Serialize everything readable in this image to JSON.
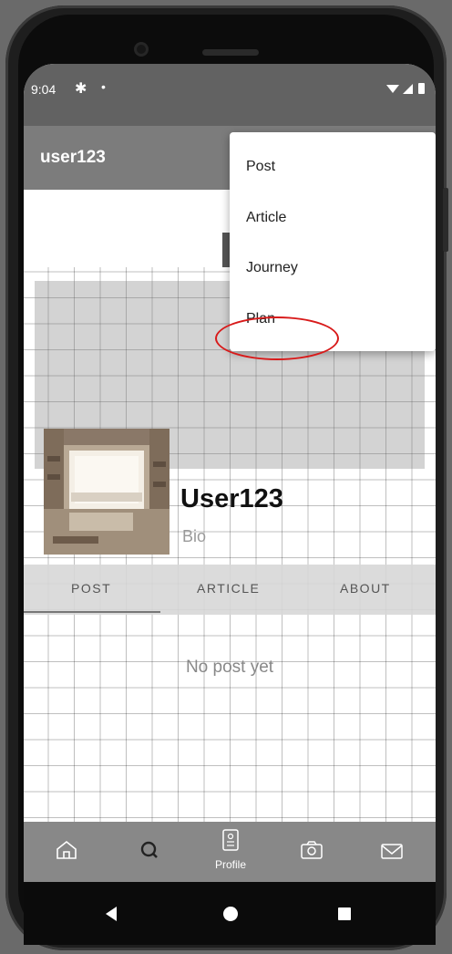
{
  "status_bar": {
    "time": "9:04"
  },
  "app_bar": {
    "title": "user123"
  },
  "overflow_menu": {
    "items": [
      {
        "label": "Post"
      },
      {
        "label": "Article"
      },
      {
        "label": "Journey"
      },
      {
        "label": "Plan"
      }
    ],
    "highlighted_item": "Journey",
    "highlight_color": "#d81a1a"
  },
  "profile": {
    "name": "User123",
    "bio": "Bio"
  },
  "tabs": [
    {
      "label": "POST",
      "selected": true
    },
    {
      "label": "ARTICLE",
      "selected": false
    },
    {
      "label": "ABOUT",
      "selected": false
    }
  ],
  "empty_state": {
    "message": "No post yet"
  },
  "bottom_nav": {
    "items": [
      {
        "icon": "home-icon",
        "label": ""
      },
      {
        "icon": "search-icon",
        "label": ""
      },
      {
        "icon": "profile-icon",
        "label": "Profile",
        "selected": true
      },
      {
        "icon": "camera-icon",
        "label": ""
      },
      {
        "icon": "mail-icon",
        "label": ""
      }
    ]
  },
  "system_nav": {
    "icons": [
      "back-icon",
      "home-circle-icon",
      "recents-icon"
    ]
  },
  "colors": {
    "status_bar": "#626262",
    "app_bar": "#7c7c7c",
    "bottom_nav": "#888888",
    "annotation": "#d81a1a"
  }
}
